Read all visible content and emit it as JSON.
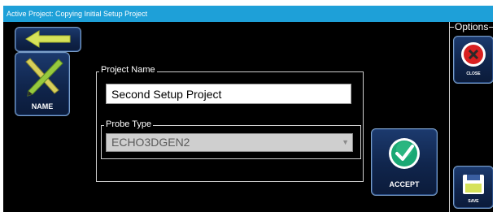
{
  "window": {
    "title": "Active Project: Copying Initial Setup Project"
  },
  "options": {
    "label": "Options"
  },
  "toolbar": {
    "back_icon": "left-arrow-icon",
    "name_label": "NAME",
    "name_icon": "pencil-ruler-icon",
    "accept_label": "ACCEPT",
    "accept_icon": "check-icon",
    "close_label": "CLOSE",
    "close_icon": "close-icon",
    "save_label": "SAVE",
    "save_icon": "save-icon"
  },
  "form": {
    "project_name_label": "Project Name",
    "project_name_value": "Second Setup Project",
    "probe_type_label": "Probe Type",
    "probe_type_value": "ECHO3DGEN2"
  },
  "colors": {
    "title_bar": "#1ea0d8",
    "background": "#000000",
    "tile": "#10254c",
    "accept": "#1aa874",
    "close": "#d92020",
    "arrow": "#d6e25a"
  }
}
